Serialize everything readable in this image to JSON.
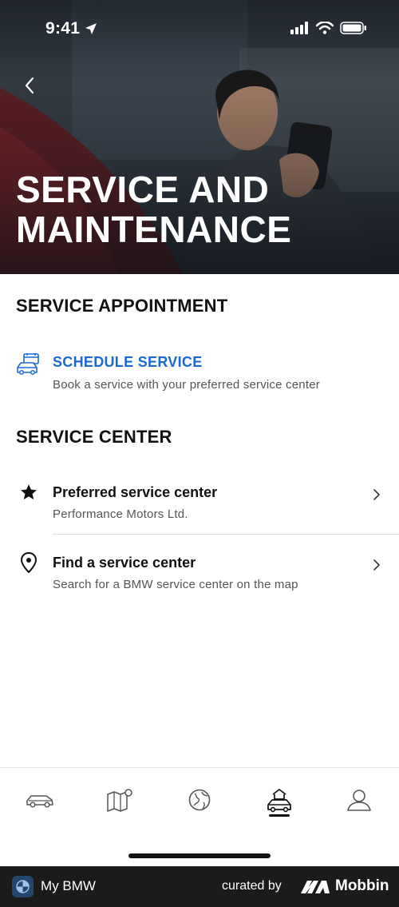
{
  "status_bar": {
    "time": "9:41"
  },
  "header": {
    "title": "SERVICE AND MAINTENANCE",
    "back_icon": "chevron-left-icon"
  },
  "service_appointment": {
    "heading": "SERVICE APPOINTMENT",
    "schedule": {
      "title": "SCHEDULE SERVICE",
      "subtitle": "Book a service with your preferred service center",
      "icon": "car-calendar-icon"
    }
  },
  "service_center": {
    "heading": "SERVICE CENTER",
    "items": [
      {
        "title": "Preferred service center",
        "subtitle": "Performance Motors Ltd.",
        "icon": "star-icon"
      },
      {
        "title": "Find a service center",
        "subtitle": "Search for a BMW service center on the map",
        "icon": "location-pin-icon"
      }
    ]
  },
  "tabbar": {
    "tabs": [
      {
        "icon": "car-icon"
      },
      {
        "icon": "map-icon"
      },
      {
        "icon": "globe-icon"
      },
      {
        "icon": "service-shop-icon",
        "active": true
      },
      {
        "icon": "profile-icon"
      }
    ]
  },
  "footer": {
    "app_name": "My BMW",
    "curated_by": "curated by",
    "brand": "Mobbin"
  },
  "colors": {
    "accent": "#1c69d4",
    "text": "#111111",
    "subtle": "#555555",
    "footer_bg": "#1b1b1b"
  }
}
